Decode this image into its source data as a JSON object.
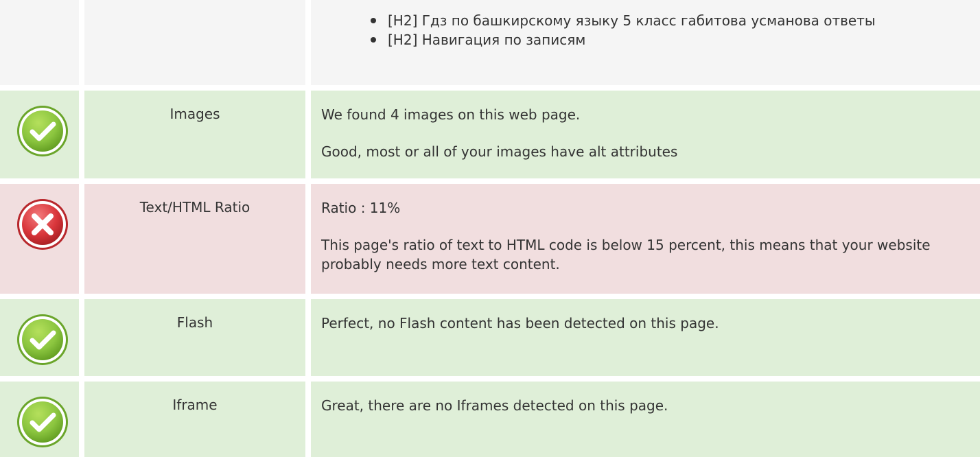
{
  "headings_section": {
    "items": [
      {
        "text": "[H2] Гдз по башкирскому языку 5 класс габитова усманова ответы"
      },
      {
        "text": "[H2] Навигация по записям"
      }
    ]
  },
  "checks": [
    {
      "status": "pass",
      "icon": "check-icon",
      "label": "Images",
      "lines": [
        "We found 4 images on this web page.",
        "Good, most or all of your images have alt attributes"
      ]
    },
    {
      "status": "fail",
      "icon": "cross-icon",
      "label": "Text/HTML Ratio",
      "lines": [
        "Ratio : 11%",
        "This page's ratio of text to HTML code is below 15 percent, this means that your website probably needs more text content."
      ]
    },
    {
      "status": "pass",
      "icon": "check-icon",
      "label": "Flash",
      "lines": [
        "Perfect, no Flash content has been detected on this page."
      ]
    },
    {
      "status": "pass",
      "icon": "check-icon",
      "label": "Iframe",
      "lines": [
        "Great, there are no Iframes detected on this page."
      ]
    }
  ],
  "colors": {
    "pass_background": "#dfefd8",
    "fail_background": "#f1dedf",
    "neutral_background": "#f5f5f5",
    "pass_icon": "#8bc53f",
    "fail_icon": "#d9363b"
  }
}
